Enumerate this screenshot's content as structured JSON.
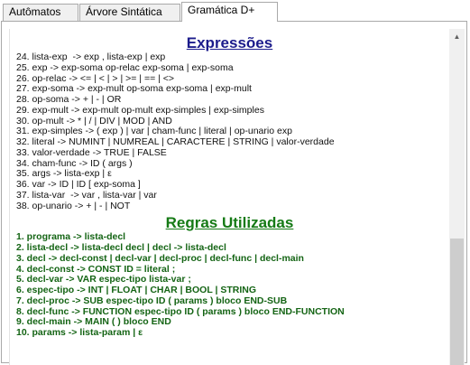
{
  "tabs": [
    {
      "label": "Autômatos",
      "active": false
    },
    {
      "label": "Árvore Sintática",
      "active": false
    },
    {
      "label": "Gramática D+",
      "active": true
    }
  ],
  "sections": {
    "expressions_title": "Expressões",
    "rules_title": "Regras Utilizadas"
  },
  "expressions": [
    "24. lista-exp  -> exp , lista-exp | exp",
    "25. exp -> exp-soma op-relac exp-soma | exp-soma",
    "26. op-relac -> <= | < | > | >= | == | <>",
    "27. exp-soma -> exp-mult op-soma exp-soma | exp-mult",
    "28. op-soma -> + | - | OR",
    "29. exp-mult -> exp-mult op-mult exp-simples | exp-simples",
    "30. op-mult -> * | / | DIV | MOD | AND",
    "31. exp-simples -> ( exp ) | var | cham-func | literal | op-unario exp",
    "32. literal -> NUMINT | NUMREAL | CARACTERE | STRING | valor-verdade",
    "33. valor-verdade -> TRUE | FALSE",
    "34. cham-func -> ID ( args )",
    "35. args -> lista-exp | ε",
    "36. var -> ID | ID [ exp-soma ]",
    "37. lista-var  -> var , lista-var | var",
    "38. op-unario -> + | - | NOT"
  ],
  "rules": [
    "1. programa -> lista-decl",
    "2. lista-decl -> lista-decl decl | decl -> lista-decl",
    "3. decl -> decl-const | decl-var | decl-proc | decl-func | decl-main",
    "4. decl-const -> CONST ID = literal ;",
    "5. decl-var -> VAR espec-tipo lista-var ;",
    "6. espec-tipo -> INT | FLOAT | CHAR | BOOL | STRING",
    "7. decl-proc -> SUB espec-tipo ID ( params ) bloco END-SUB",
    "8. decl-func -> FUNCTION espec-tipo ID ( params ) bloco END-FUNCTION",
    "9. decl-main -> MAIN ( ) bloco END",
    "10. params -> lista-param | ε"
  ],
  "scrollbar": {
    "up_icon": "scroll-up-arrow-icon",
    "position_fraction": 0.85
  },
  "colors": {
    "expressions_title": "#1c1c8c",
    "rules_title": "#157a15",
    "rule_text": "#146414"
  }
}
